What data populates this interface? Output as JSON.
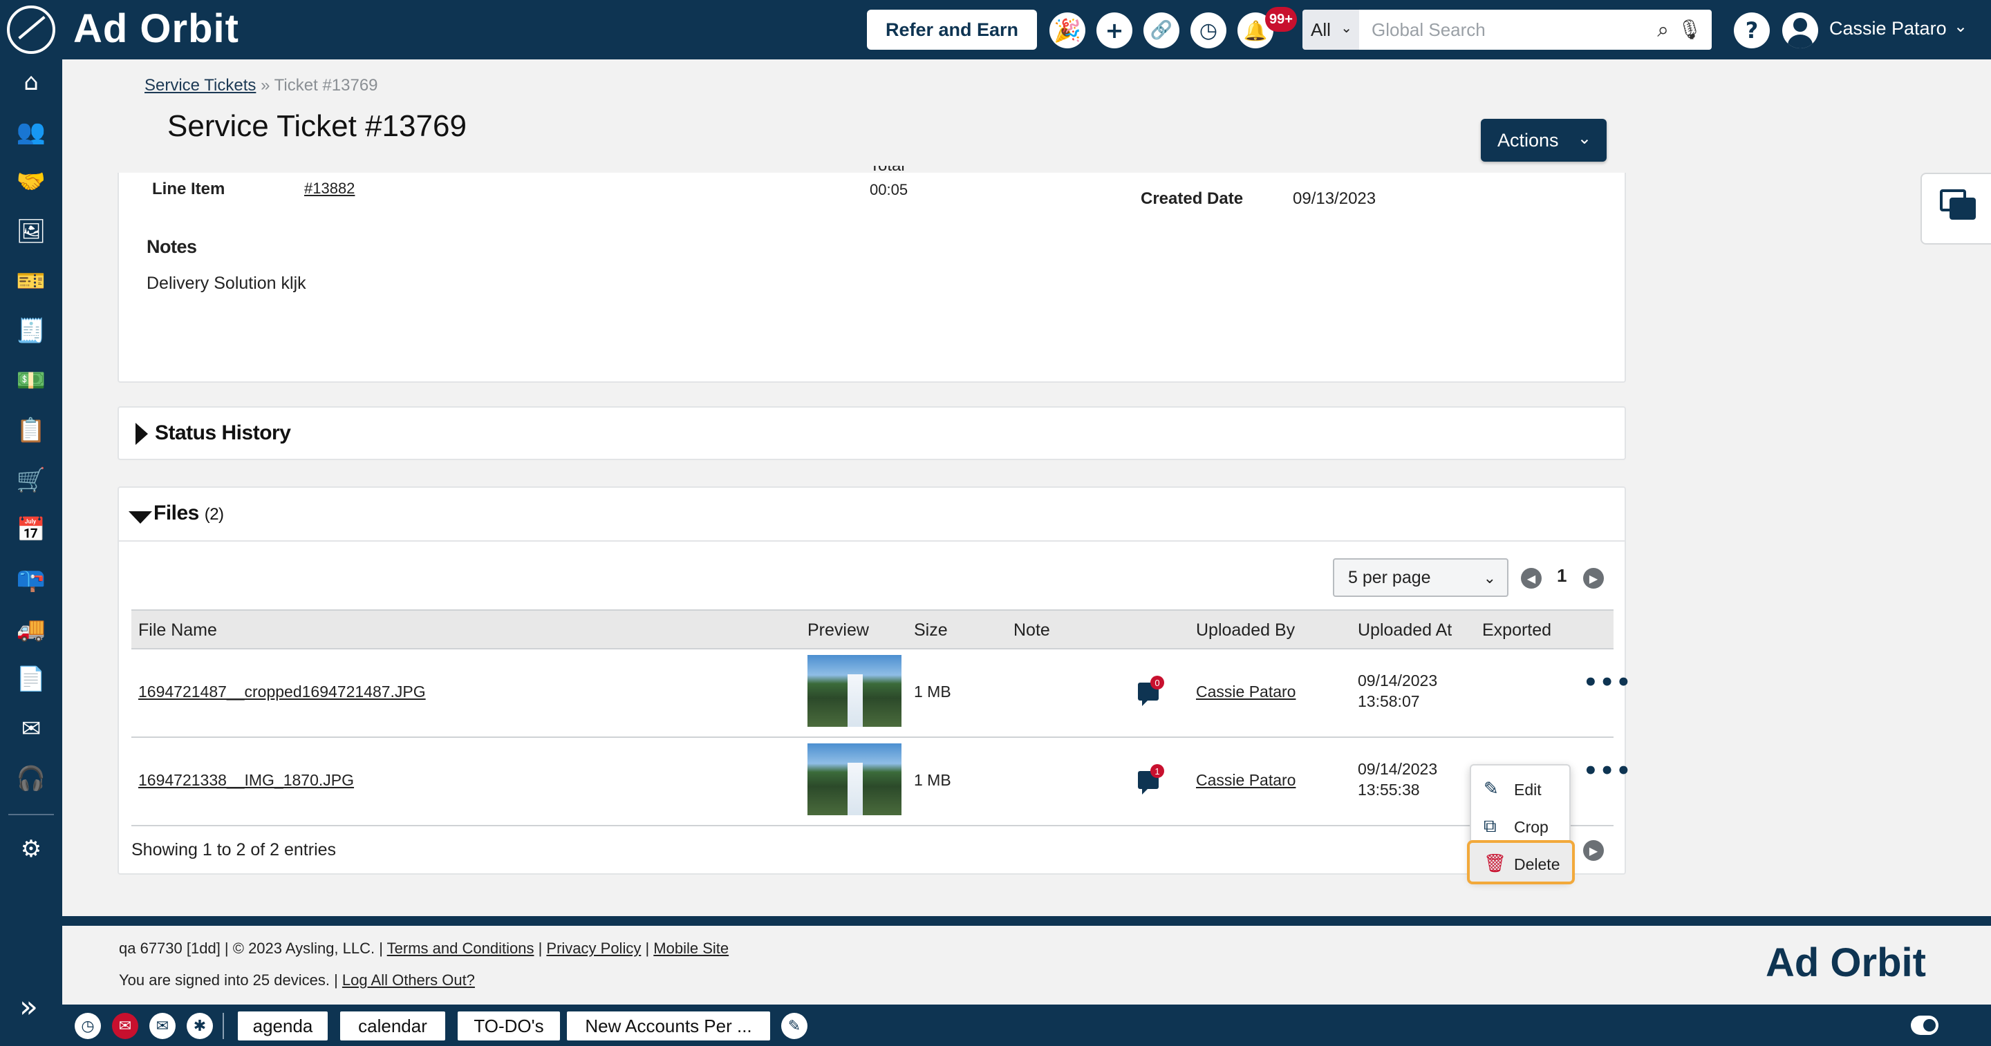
{
  "header": {
    "brand": "Ad Orbit",
    "refer_label": "Refer and Earn",
    "notifications_badge": "99+",
    "search_scope": "All",
    "search_placeholder": "Global Search",
    "user_name": "Cassie Pataro"
  },
  "breadcrumb": {
    "parent": "Service Tickets",
    "separator": "»",
    "current": "Ticket #13769"
  },
  "page": {
    "title": "Service Ticket #13769",
    "actions_label": "Actions"
  },
  "details": {
    "line_item_label": "Line Item",
    "line_item_value": "#13882",
    "total_label": "Total",
    "total_value": "00:05",
    "created_label": "Created Date",
    "created_value": "09/13/2023",
    "notes_label": "Notes",
    "notes_value": "Delivery Solution kljk"
  },
  "status_history": {
    "title": "Status History"
  },
  "files": {
    "title": "Files",
    "count": "(2)",
    "per_page": "5 per page",
    "page_number": "1",
    "columns": [
      "File Name",
      "Preview",
      "Size",
      "Note",
      "Uploaded By",
      "Uploaded At",
      "Exported"
    ],
    "rows": [
      {
        "file_name": "1694721487__cropped1694721487.JPG",
        "size": "1 MB",
        "note_count": "0",
        "uploaded_by": "Cassie Pataro",
        "uploaded_date": "09/14/2023",
        "uploaded_time": "13:58:07"
      },
      {
        "file_name": "1694721338__IMG_1870.JPG",
        "size": "1 MB",
        "note_count": "1",
        "uploaded_by": "Cassie Pataro",
        "uploaded_date": "09/14/2023",
        "uploaded_time": "13:55:38"
      }
    ],
    "showing": "Showing 1 to 2 of 2 entries"
  },
  "context_menu": {
    "edit": "Edit",
    "crop": "Crop",
    "delete": "Delete"
  },
  "footer": {
    "line1_prefix": "qa 67730 [1dd] | © 2023 Aysling, LLC. |",
    "terms": "Terms and Conditions",
    "privacy": "Privacy Policy",
    "mobile": "Mobile Site",
    "line2_prefix": "You are signed into 25 devices. |",
    "logout_others": "Log All Others Out?",
    "brand": "Ad Orbit"
  },
  "taskbar": {
    "agenda": "agenda",
    "calendar": "calendar",
    "todos": "TO-DO's",
    "new_accounts": "New Accounts Per ..."
  },
  "colors": {
    "navy": "#0e3452",
    "badge_red": "#c8102e",
    "highlight_orange": "#f2a93b"
  }
}
